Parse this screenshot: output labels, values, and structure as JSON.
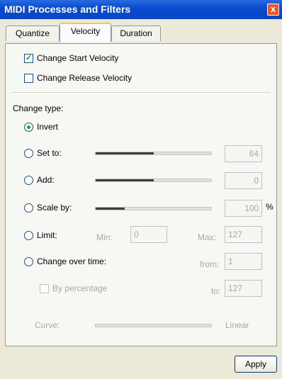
{
  "window": {
    "title": "MIDI Processes and Filters",
    "close_glyph": "x"
  },
  "tabs": [
    {
      "label": "Quantize",
      "active": false
    },
    {
      "label": "Velocity",
      "active": true
    },
    {
      "label": "Duration",
      "active": false
    }
  ],
  "options": {
    "change_start_velocity": {
      "label": "Change Start Velocity",
      "checked": true
    },
    "change_release_velocity": {
      "label": "Change Release Velocity",
      "checked": false
    }
  },
  "change_type": {
    "label": "Change type:",
    "invert": {
      "label": "Invert",
      "selected": true
    },
    "set_to": {
      "label": "Set to:",
      "value": "64",
      "slider_fraction": 0.5
    },
    "add": {
      "label": "Add:",
      "value": "0",
      "slider_fraction": 0.5
    },
    "scale_by": {
      "label": "Scale by:",
      "value": "100",
      "unit": "%",
      "slider_fraction": 0.25
    },
    "limit": {
      "label": "Limit:",
      "min_label": "Min:",
      "min_value": "0",
      "max_label": "Max:",
      "max_value": "127"
    },
    "change_over_time": {
      "label": "Change over time:",
      "from_label": "from:",
      "from_value": "1",
      "to_label": "to:",
      "to_value": "127"
    },
    "by_percentage": {
      "label": "By percentage",
      "checked": false
    },
    "curve": {
      "label": "Curve:",
      "value_label": "Linear"
    }
  },
  "buttons": {
    "apply": "Apply"
  }
}
